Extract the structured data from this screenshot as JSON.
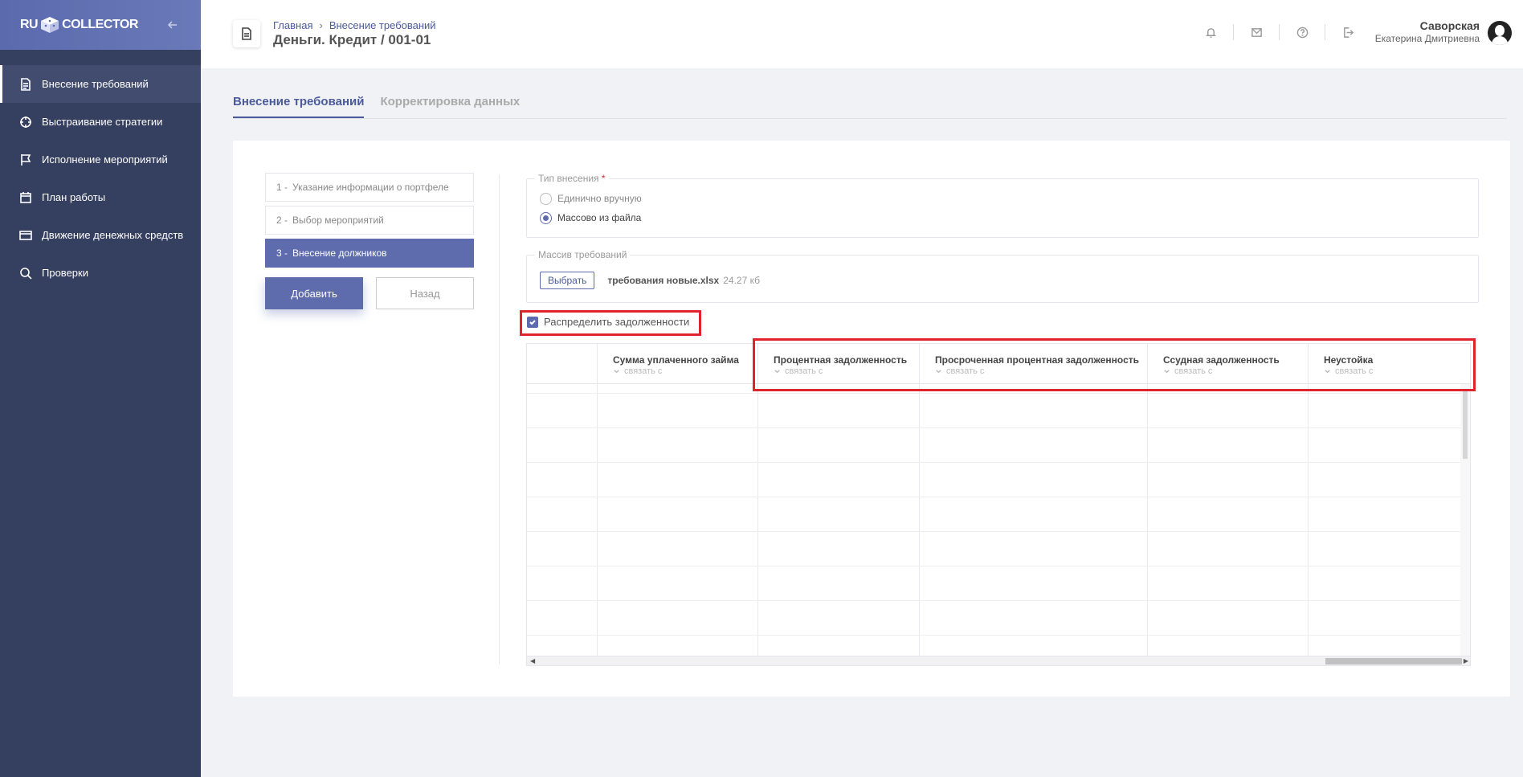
{
  "sidebar": {
    "logo_left": "RU",
    "logo_right": "COLLECTOR",
    "collapse_icon": "arrow-left-icon",
    "items": [
      {
        "label": "Внесение требований",
        "icon": "document-icon",
        "active": true
      },
      {
        "label": "Выстраивание стратегии",
        "icon": "crosshair-icon",
        "active": false
      },
      {
        "label": "Исполнение мероприятий",
        "icon": "flag-icon",
        "active": false
      },
      {
        "label": "План работы",
        "icon": "calendar-icon",
        "active": false
      },
      {
        "label": "Движение денежных средств",
        "icon": "card-icon",
        "active": false
      },
      {
        "label": "Проверки",
        "icon": "search-icon",
        "active": false
      }
    ]
  },
  "header": {
    "breadcrumb": [
      "Главная",
      "Внесение требований"
    ],
    "title": "Деньги. Кредит / 001-01",
    "icons": [
      "bell-icon",
      "mail-icon",
      "help-icon",
      "logout-icon"
    ],
    "user": {
      "last_name": "Саворская",
      "first_name": "Екатерина Дмитриевна"
    }
  },
  "tabs": [
    {
      "label": "Внесение требований",
      "active": true
    },
    {
      "label": "Корректировка данных",
      "active": false
    }
  ],
  "steps": [
    {
      "num": "1 -",
      "label": "Указание информации о портфеле",
      "active": false
    },
    {
      "num": "2 -",
      "label": "Выбор мероприятий",
      "active": false
    },
    {
      "num": "3 -",
      "label": "Внесение должников",
      "active": true
    }
  ],
  "buttons": {
    "add": "Добавить",
    "back": "Назад"
  },
  "type_section": {
    "legend": "Тип внесения",
    "required_mark": "*",
    "options": [
      {
        "label": "Единично вручную",
        "checked": false
      },
      {
        "label": "Массово из файла",
        "checked": true
      }
    ]
  },
  "file_section": {
    "legend": "Массив требований",
    "choose_label": "Выбрать",
    "file_name": "требования новые.xlsx",
    "file_size": "24.27 кб"
  },
  "distribute": {
    "label": "Распределить задолженности",
    "checked": true
  },
  "table": {
    "link_label": "связать с",
    "columns": [
      {
        "title": ""
      },
      {
        "title": "Сумма уплаченного займа"
      },
      {
        "title": "Процентная задолженность"
      },
      {
        "title": "Просроченная процентная задолженность"
      },
      {
        "title": "Ссудная задолженность"
      },
      {
        "title": "Неустойка"
      }
    ]
  }
}
